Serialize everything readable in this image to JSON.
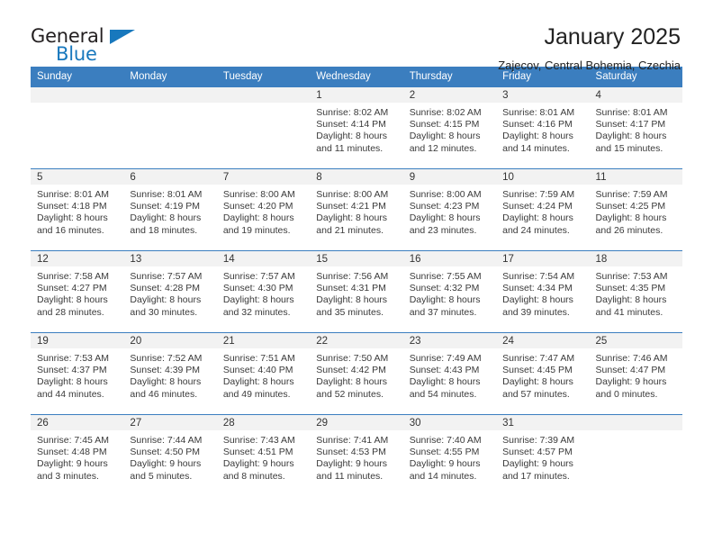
{
  "logo": {
    "word_top": "General",
    "word_bottom": "Blue",
    "accent_color": "#1878bd"
  },
  "header": {
    "title": "January 2025",
    "subtitle": "Zajecov, Central Bohemia, Czechia"
  },
  "theme": {
    "header_blue": "#3b7ebf",
    "daynum_band": "#f2f2f2",
    "text": "#222222"
  },
  "calendar": {
    "weekday_headers": [
      "Sunday",
      "Monday",
      "Tuesday",
      "Wednesday",
      "Thursday",
      "Friday",
      "Saturday"
    ],
    "weeks": [
      [
        {
          "day": "",
          "empty": true
        },
        {
          "day": "",
          "empty": true
        },
        {
          "day": "",
          "empty": true
        },
        {
          "day": "1",
          "sunrise": "Sunrise: 8:02 AM",
          "sunset": "Sunset: 4:14 PM",
          "daylight1": "Daylight: 8 hours",
          "daylight2": "and 11 minutes."
        },
        {
          "day": "2",
          "sunrise": "Sunrise: 8:02 AM",
          "sunset": "Sunset: 4:15 PM",
          "daylight1": "Daylight: 8 hours",
          "daylight2": "and 12 minutes."
        },
        {
          "day": "3",
          "sunrise": "Sunrise: 8:01 AM",
          "sunset": "Sunset: 4:16 PM",
          "daylight1": "Daylight: 8 hours",
          "daylight2": "and 14 minutes."
        },
        {
          "day": "4",
          "sunrise": "Sunrise: 8:01 AM",
          "sunset": "Sunset: 4:17 PM",
          "daylight1": "Daylight: 8 hours",
          "daylight2": "and 15 minutes."
        }
      ],
      [
        {
          "day": "5",
          "sunrise": "Sunrise: 8:01 AM",
          "sunset": "Sunset: 4:18 PM",
          "daylight1": "Daylight: 8 hours",
          "daylight2": "and 16 minutes."
        },
        {
          "day": "6",
          "sunrise": "Sunrise: 8:01 AM",
          "sunset": "Sunset: 4:19 PM",
          "daylight1": "Daylight: 8 hours",
          "daylight2": "and 18 minutes."
        },
        {
          "day": "7",
          "sunrise": "Sunrise: 8:00 AM",
          "sunset": "Sunset: 4:20 PM",
          "daylight1": "Daylight: 8 hours",
          "daylight2": "and 19 minutes."
        },
        {
          "day": "8",
          "sunrise": "Sunrise: 8:00 AM",
          "sunset": "Sunset: 4:21 PM",
          "daylight1": "Daylight: 8 hours",
          "daylight2": "and 21 minutes."
        },
        {
          "day": "9",
          "sunrise": "Sunrise: 8:00 AM",
          "sunset": "Sunset: 4:23 PM",
          "daylight1": "Daylight: 8 hours",
          "daylight2": "and 23 minutes."
        },
        {
          "day": "10",
          "sunrise": "Sunrise: 7:59 AM",
          "sunset": "Sunset: 4:24 PM",
          "daylight1": "Daylight: 8 hours",
          "daylight2": "and 24 minutes."
        },
        {
          "day": "11",
          "sunrise": "Sunrise: 7:59 AM",
          "sunset": "Sunset: 4:25 PM",
          "daylight1": "Daylight: 8 hours",
          "daylight2": "and 26 minutes."
        }
      ],
      [
        {
          "day": "12",
          "sunrise": "Sunrise: 7:58 AM",
          "sunset": "Sunset: 4:27 PM",
          "daylight1": "Daylight: 8 hours",
          "daylight2": "and 28 minutes."
        },
        {
          "day": "13",
          "sunrise": "Sunrise: 7:57 AM",
          "sunset": "Sunset: 4:28 PM",
          "daylight1": "Daylight: 8 hours",
          "daylight2": "and 30 minutes."
        },
        {
          "day": "14",
          "sunrise": "Sunrise: 7:57 AM",
          "sunset": "Sunset: 4:30 PM",
          "daylight1": "Daylight: 8 hours",
          "daylight2": "and 32 minutes."
        },
        {
          "day": "15",
          "sunrise": "Sunrise: 7:56 AM",
          "sunset": "Sunset: 4:31 PM",
          "daylight1": "Daylight: 8 hours",
          "daylight2": "and 35 minutes."
        },
        {
          "day": "16",
          "sunrise": "Sunrise: 7:55 AM",
          "sunset": "Sunset: 4:32 PM",
          "daylight1": "Daylight: 8 hours",
          "daylight2": "and 37 minutes."
        },
        {
          "day": "17",
          "sunrise": "Sunrise: 7:54 AM",
          "sunset": "Sunset: 4:34 PM",
          "daylight1": "Daylight: 8 hours",
          "daylight2": "and 39 minutes."
        },
        {
          "day": "18",
          "sunrise": "Sunrise: 7:53 AM",
          "sunset": "Sunset: 4:35 PM",
          "daylight1": "Daylight: 8 hours",
          "daylight2": "and 41 minutes."
        }
      ],
      [
        {
          "day": "19",
          "sunrise": "Sunrise: 7:53 AM",
          "sunset": "Sunset: 4:37 PM",
          "daylight1": "Daylight: 8 hours",
          "daylight2": "and 44 minutes."
        },
        {
          "day": "20",
          "sunrise": "Sunrise: 7:52 AM",
          "sunset": "Sunset: 4:39 PM",
          "daylight1": "Daylight: 8 hours",
          "daylight2": "and 46 minutes."
        },
        {
          "day": "21",
          "sunrise": "Sunrise: 7:51 AM",
          "sunset": "Sunset: 4:40 PM",
          "daylight1": "Daylight: 8 hours",
          "daylight2": "and 49 minutes."
        },
        {
          "day": "22",
          "sunrise": "Sunrise: 7:50 AM",
          "sunset": "Sunset: 4:42 PM",
          "daylight1": "Daylight: 8 hours",
          "daylight2": "and 52 minutes."
        },
        {
          "day": "23",
          "sunrise": "Sunrise: 7:49 AM",
          "sunset": "Sunset: 4:43 PM",
          "daylight1": "Daylight: 8 hours",
          "daylight2": "and 54 minutes."
        },
        {
          "day": "24",
          "sunrise": "Sunrise: 7:47 AM",
          "sunset": "Sunset: 4:45 PM",
          "daylight1": "Daylight: 8 hours",
          "daylight2": "and 57 minutes."
        },
        {
          "day": "25",
          "sunrise": "Sunrise: 7:46 AM",
          "sunset": "Sunset: 4:47 PM",
          "daylight1": "Daylight: 9 hours",
          "daylight2": "and 0 minutes."
        }
      ],
      [
        {
          "day": "26",
          "sunrise": "Sunrise: 7:45 AM",
          "sunset": "Sunset: 4:48 PM",
          "daylight1": "Daylight: 9 hours",
          "daylight2": "and 3 minutes."
        },
        {
          "day": "27",
          "sunrise": "Sunrise: 7:44 AM",
          "sunset": "Sunset: 4:50 PM",
          "daylight1": "Daylight: 9 hours",
          "daylight2": "and 5 minutes."
        },
        {
          "day": "28",
          "sunrise": "Sunrise: 7:43 AM",
          "sunset": "Sunset: 4:51 PM",
          "daylight1": "Daylight: 9 hours",
          "daylight2": "and 8 minutes."
        },
        {
          "day": "29",
          "sunrise": "Sunrise: 7:41 AM",
          "sunset": "Sunset: 4:53 PM",
          "daylight1": "Daylight: 9 hours",
          "daylight2": "and 11 minutes."
        },
        {
          "day": "30",
          "sunrise": "Sunrise: 7:40 AM",
          "sunset": "Sunset: 4:55 PM",
          "daylight1": "Daylight: 9 hours",
          "daylight2": "and 14 minutes."
        },
        {
          "day": "31",
          "sunrise": "Sunrise: 7:39 AM",
          "sunset": "Sunset: 4:57 PM",
          "daylight1": "Daylight: 9 hours",
          "daylight2": "and 17 minutes."
        },
        {
          "day": "",
          "empty": true
        }
      ]
    ]
  }
}
